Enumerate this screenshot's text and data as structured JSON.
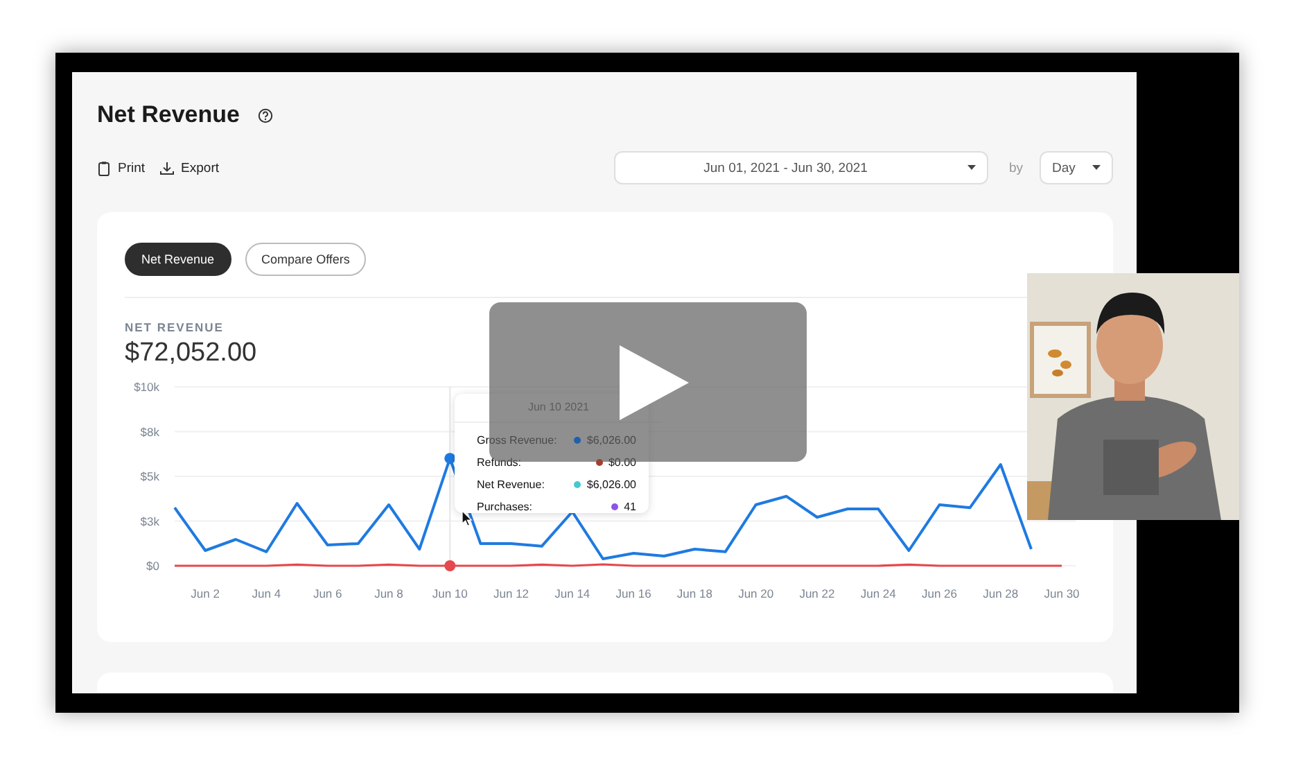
{
  "page": {
    "title": "Net Revenue",
    "actions": [
      {
        "label": "Print"
      },
      {
        "label": "Export"
      }
    ],
    "date_range": {
      "value": "Jun 01, 2021 - Jun 30, 2021"
    },
    "by_label": "by",
    "interval": {
      "value": "Day"
    }
  },
  "card": {
    "tabs": [
      {
        "label": "Net Revenue",
        "selected": true
      },
      {
        "label": "Compare Offers",
        "selected": false
      }
    ],
    "metric_label": "NET REVENUE",
    "metric_value": "$72,052.00",
    "chart_data": {
      "type": "line",
      "categories": [
        null,
        "Jun 2",
        null,
        "Jun 4",
        null,
        "Jun 6",
        null,
        "Jun 8",
        null,
        "Jun 10",
        null,
        "Jun 12",
        null,
        "Jun 14",
        null,
        "Jun 16",
        null,
        "Jun 18",
        null,
        "Jun 20",
        null,
        "Jun 22",
        null,
        "Jun 24",
        null,
        "Jun 26",
        null,
        "Jun 28",
        null,
        "Jun 30"
      ],
      "grid": true,
      "series": [
        {
          "color": "#1f7ae0",
          "values": [
            3250,
            850,
            1470,
            780,
            3490,
            1160,
            1240,
            3410,
            930,
            6000,
            1240,
            1240,
            1090,
            3020,
            390,
            700,
            540,
            930,
            780,
            3410,
            3880,
            2710,
            3180,
            3180,
            850,
            3410,
            3250,
            5660,
            930,
            null
          ]
        },
        {
          "color": "#e5484d",
          "values": [
            0,
            0,
            0,
            0,
            60,
            0,
            0,
            60,
            0,
            0,
            0,
            0,
            60,
            0,
            80,
            0,
            0,
            0,
            0,
            0,
            0,
            0,
            0,
            0,
            60,
            0,
            0,
            0,
            0,
            0
          ]
        }
      ],
      "ylim": [
        0,
        10000
      ],
      "yticks": [
        {
          "value": 0,
          "label": "$0"
        },
        {
          "value": 2500,
          "label": "$3k"
        },
        {
          "value": 5000,
          "label": "$5k"
        },
        {
          "value": 7500,
          "label": "$8k"
        },
        {
          "value": 10000,
          "label": "$10k"
        }
      ],
      "ref_lines": [
        {
          "axis": "x",
          "value": "Jun 10",
          "color": "#e6e6e8"
        }
      ]
    },
    "tooltip": {
      "title": "Jun 10 2021",
      "rows": [
        {
          "label": "Gross Revenue:",
          "value": "$6,026.00",
          "color": "#1f5fae"
        },
        {
          "label": "Refunds:",
          "value": "$0.00",
          "color": "#a0412f"
        },
        {
          "label": "Net Revenue:",
          "value": "$6,026.00",
          "color": "#45c9d3"
        },
        {
          "label": "Purchases:",
          "value": "41",
          "color": "#8b55e6"
        }
      ]
    }
  }
}
